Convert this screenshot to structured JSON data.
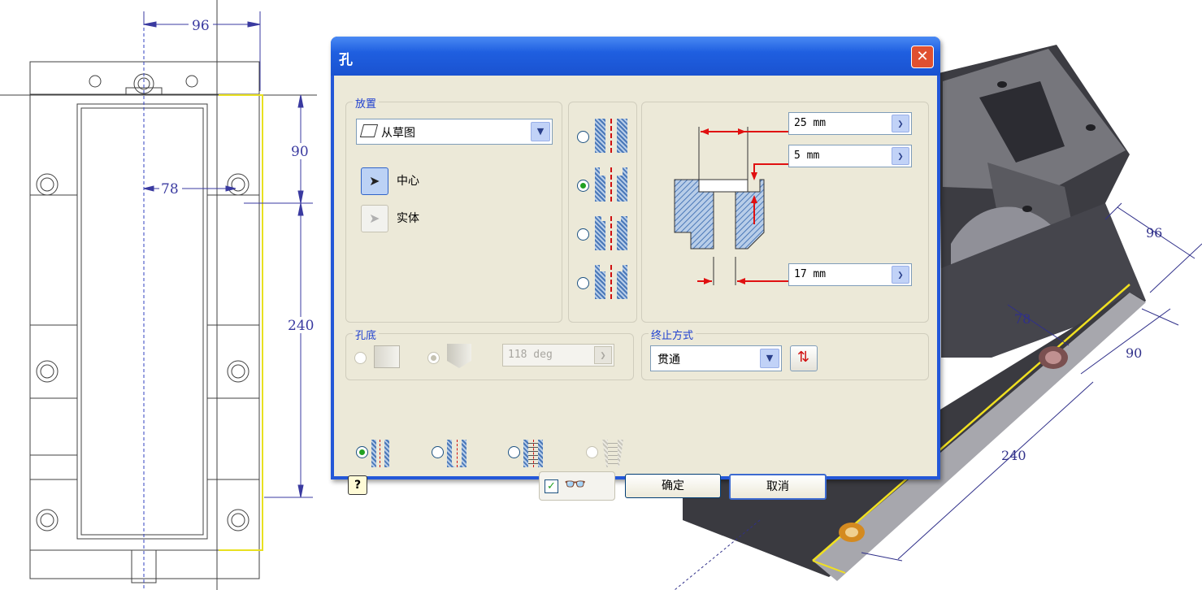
{
  "drawing_2d": {
    "dim_top": "96",
    "dim_hole": "78",
    "dim_right_upper": "90",
    "dim_right_lower": "240"
  },
  "model_3d": {
    "dim_96": "96",
    "dim_78": "78",
    "dim_90": "90",
    "dim_240": "240"
  },
  "dialog": {
    "title": "孔",
    "close_glyph": "✕",
    "placement": {
      "label": "放置",
      "source_value": "从草图",
      "center_label": "中心",
      "solid_label": "实体"
    },
    "hole_types": [
      {
        "selected": false
      },
      {
        "selected": true
      },
      {
        "selected": false
      },
      {
        "selected": false
      }
    ],
    "values": {
      "cbore_diameter": "25 mm",
      "cbore_depth": "5 mm",
      "hole_diameter": "17 mm"
    },
    "drill_point": {
      "label": "孔底",
      "angle": "118 deg"
    },
    "termination": {
      "label": "终止方式",
      "value": "贯通"
    },
    "ok_label": "确定",
    "cancel_label": "取消",
    "help_glyph": "?"
  }
}
